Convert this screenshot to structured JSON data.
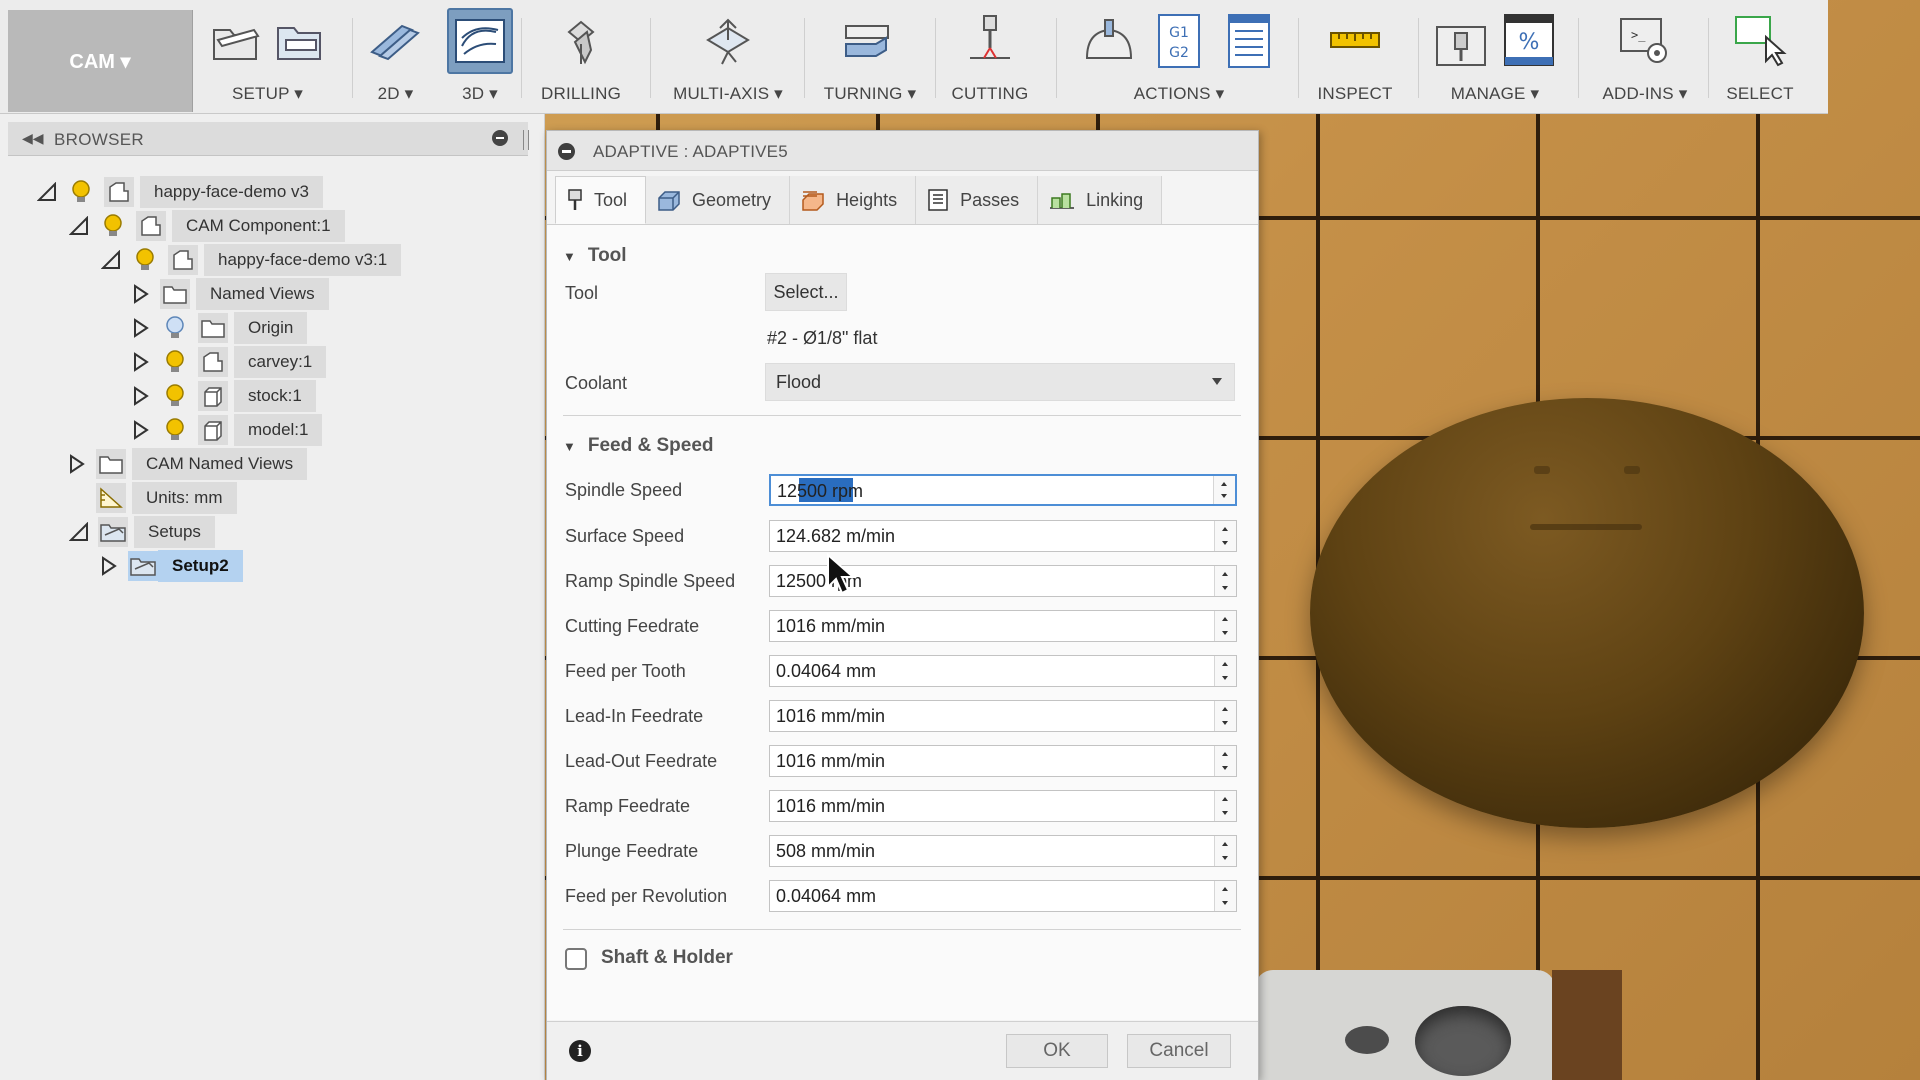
{
  "workspace": {
    "label": "CAM ▾"
  },
  "toolbar": {
    "setup_label": "SETUP ▾",
    "2d_label": "2D ▾",
    "3d_label": "3D ▾",
    "drilling_label": "DRILLING",
    "multiaxis_label": "MULTI-AXIS ▾",
    "turning_label": "TURNING ▾",
    "cutting_label": "CUTTING",
    "actions_label": "ACTIONS ▾",
    "inspect_label": "INSPECT",
    "manage_label": "MANAGE ▾",
    "addins_label": "ADD-INS ▾",
    "select_label": "SELECT",
    "g1g2_text": "G1 G2",
    "percent_text": "%"
  },
  "browser": {
    "title": "BROWSER",
    "items": [
      {
        "label": "happy-face-demo v3"
      },
      {
        "label": "CAM Component:1"
      },
      {
        "label": "happy-face-demo v3:1"
      },
      {
        "label": "Named Views"
      },
      {
        "label": "Origin"
      },
      {
        "label": "carvey:1"
      },
      {
        "label": "stock:1"
      },
      {
        "label": "model:1"
      },
      {
        "label": "CAM Named Views"
      },
      {
        "label": "Units: mm"
      },
      {
        "label": "Setups"
      },
      {
        "label": "Setup2"
      }
    ]
  },
  "dialog": {
    "title": "ADAPTIVE : ADAPTIVE5",
    "tabs": [
      {
        "label": "Tool"
      },
      {
        "label": "Geometry"
      },
      {
        "label": "Heights"
      },
      {
        "label": "Passes"
      },
      {
        "label": "Linking"
      }
    ],
    "tool_section": {
      "header": "Tool",
      "tool_label": "Tool",
      "select_button": "Select...",
      "tool_desc": "#2 - Ø1/8\" flat",
      "coolant_label": "Coolant",
      "coolant_value": "Flood"
    },
    "feed_section": {
      "header": "Feed & Speed",
      "fields": [
        {
          "label": "Spindle Speed",
          "value": "12500 rpm"
        },
        {
          "label": "Surface Speed",
          "value": "124.682 m/min"
        },
        {
          "label": "Ramp Spindle Speed",
          "value": "12500 rpm"
        },
        {
          "label": "Cutting Feedrate",
          "value": "1016 mm/min"
        },
        {
          "label": "Feed per Tooth",
          "value": "0.04064 mm"
        },
        {
          "label": "Lead-In Feedrate",
          "value": "1016 mm/min"
        },
        {
          "label": "Lead-Out Feedrate",
          "value": "1016 mm/min"
        },
        {
          "label": "Ramp Feedrate",
          "value": "1016 mm/min"
        },
        {
          "label": "Plunge Feedrate",
          "value": "508 mm/min"
        },
        {
          "label": "Feed per Revolution",
          "value": "0.04064 mm"
        }
      ]
    },
    "shaft_label": "Shaft & Holder",
    "ok_label": "OK",
    "cancel_label": "Cancel"
  },
  "colors": {
    "accent": "#2a6dbf",
    "selection": "#b4d2f0",
    "bulb": "#f2c200",
    "bulb_off": "#8fb4e0"
  }
}
